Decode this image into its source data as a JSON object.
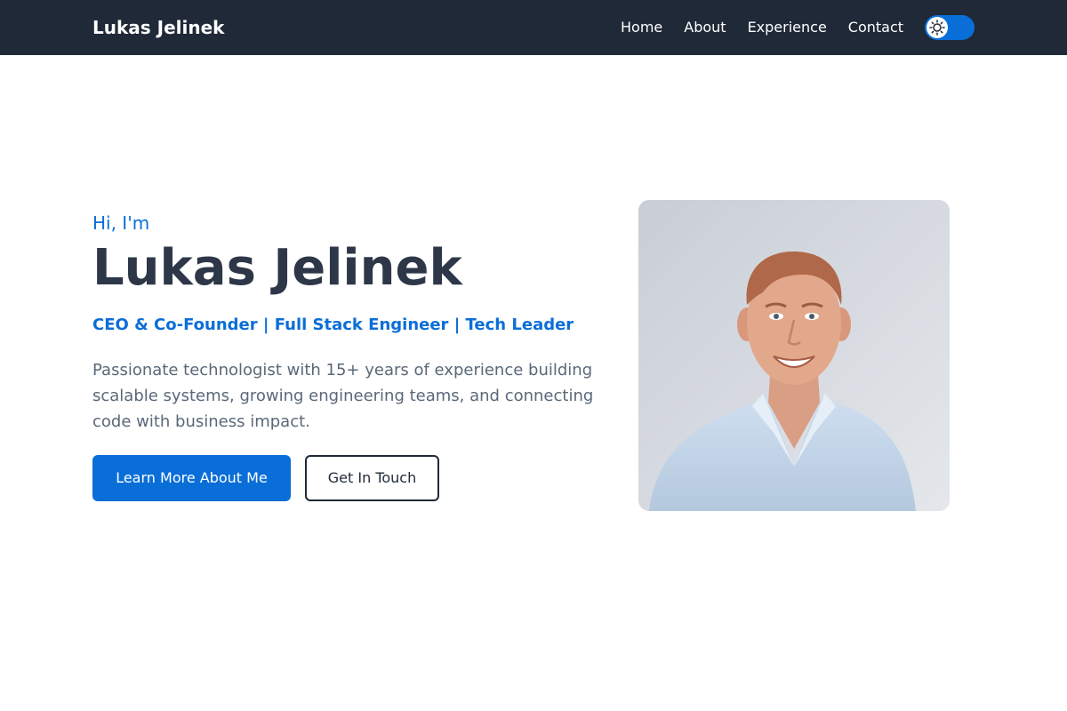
{
  "colors": {
    "navbar_bg": "#1f2937",
    "accent": "#0a6ed8",
    "heading": "#2d3748",
    "body_text": "#5a6878"
  },
  "navbar": {
    "brand": "Lukas Jelinek",
    "links": [
      {
        "label": "Home"
      },
      {
        "label": "About"
      },
      {
        "label": "Experience"
      },
      {
        "label": "Contact"
      }
    ],
    "theme_toggle": {
      "icon": "sun-icon",
      "state": "light"
    }
  },
  "hero": {
    "greeting": "Hi, I'm",
    "name": "Lukas Jelinek",
    "subtitle": "CEO & Co-Founder | Full Stack Engineer | Tech Leader",
    "description": "Passionate technologist with 15+ years of experience building scalable systems, growing engineering teams, and connecting code with business impact.",
    "primary_button": "Learn More About Me",
    "secondary_button": "Get In Touch"
  }
}
